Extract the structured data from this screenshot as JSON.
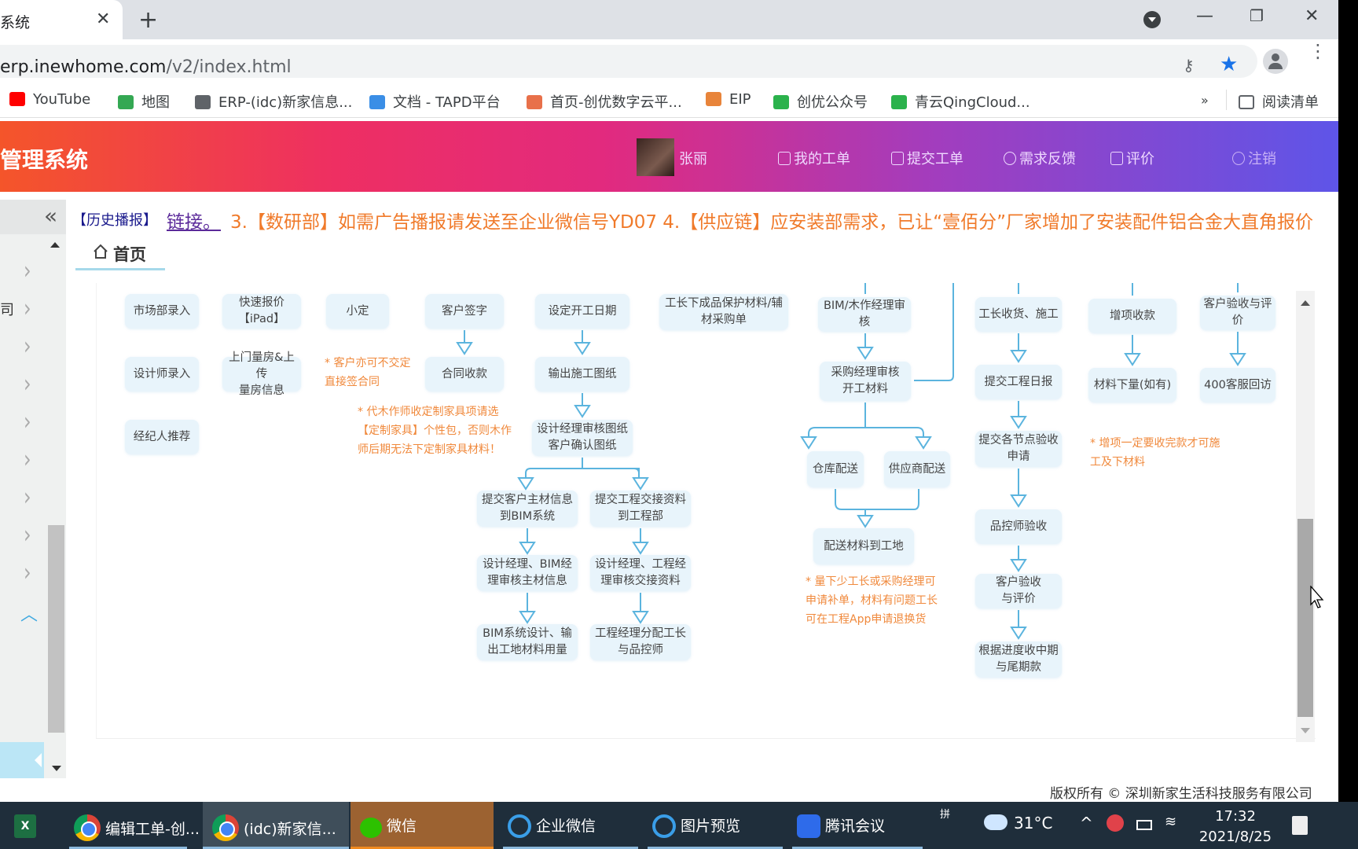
{
  "browser": {
    "tab_title": "系统",
    "url_host": "erp.inewhome.com",
    "url_path": "/v2/index.html",
    "bookmarks": [
      {
        "label": "YouTube",
        "icon": "youtube-icon",
        "color": "#ff0000"
      },
      {
        "label": "地图",
        "icon": "maps-icon",
        "color": "#34a853"
      },
      {
        "label": "ERP-(idc)新家信息...",
        "icon": "globe-icon",
        "color": "#5f6368"
      },
      {
        "label": "文档 - TAPD平台",
        "icon": "tapd-icon",
        "color": "#3a8ee6"
      },
      {
        "label": "首页-创优数字云平...",
        "icon": "home-icon",
        "color": "#e8704a"
      },
      {
        "label": "EIP",
        "icon": "eip-icon",
        "color": "#e8843a"
      },
      {
        "label": "创优公众号",
        "icon": "refresh-icon",
        "color": "#2bb24c"
      },
      {
        "label": "青云QingCloud...",
        "icon": "qingcloud-icon",
        "color": "#2bb24c"
      }
    ],
    "more_bookmarks": "»",
    "reading_list": "阅读清单"
  },
  "app": {
    "title": "管理系统",
    "user_name": "张丽",
    "nav": [
      {
        "label": "我的工单",
        "icon": "my-ticket-icon"
      },
      {
        "label": "提交工单",
        "icon": "submit-ticket-icon"
      },
      {
        "label": "需求反馈",
        "icon": "feedback-icon"
      },
      {
        "label": "评价",
        "icon": "comment-icon"
      },
      {
        "label": "注销",
        "icon": "logout-icon"
      }
    ]
  },
  "sidebar": {
    "items": [
      {
        "label": ""
      },
      {
        "label": "司"
      },
      {
        "label": ""
      },
      {
        "label": ""
      },
      {
        "label": ""
      },
      {
        "label": ""
      },
      {
        "label": ""
      },
      {
        "label": ""
      },
      {
        "label": ""
      }
    ]
  },
  "notice": {
    "tag": "【历史播报】",
    "link": "链接。",
    "message": "3.【数研部】如需广告播报请发送至企业微信号YD07 4.【供应链】应安装部需求，已让“壹佰分”厂家增加了安装配件铝合金大直角报价"
  },
  "home_tab": {
    "label": "首页"
  },
  "flowchart": {
    "nodes": [
      {
        "id": "n1",
        "text": "市场部录入"
      },
      {
        "id": "n2",
        "text": "设计师录入"
      },
      {
        "id": "n3",
        "text": "经纪人推荐"
      },
      {
        "id": "n4",
        "text": "快速报价\n【iPad】"
      },
      {
        "id": "n5",
        "text": "上门量房&上传\n量房信息"
      },
      {
        "id": "n6",
        "text": "小定"
      },
      {
        "id": "n7",
        "text": "客户签字"
      },
      {
        "id": "n8",
        "text": "合同收款"
      },
      {
        "id": "n9",
        "text": "设定开工日期"
      },
      {
        "id": "n10",
        "text": "输出施工图纸"
      },
      {
        "id": "n11",
        "text": "设计经理审核图纸\n客户确认图纸"
      },
      {
        "id": "n12",
        "text": "提交客户主材信息\n到BIM系统"
      },
      {
        "id": "n13",
        "text": "设计经理、BIM经\n理审核主材信息"
      },
      {
        "id": "n14",
        "text": "BIM系统设计、输\n出工地材料用量"
      },
      {
        "id": "n15",
        "text": "提交工程交接资料\n到工程部"
      },
      {
        "id": "n16",
        "text": "设计经理、工程经\n理审核交接资料"
      },
      {
        "id": "n17",
        "text": "工程经理分配工长\n与品控师"
      },
      {
        "id": "n18",
        "text": "工长下成品保护材料/辅\n材采购单"
      },
      {
        "id": "n19",
        "text": "BIM/木作经理审核"
      },
      {
        "id": "n20",
        "text": "采购经理审核\n开工材料"
      },
      {
        "id": "n21",
        "text": "仓库配送"
      },
      {
        "id": "n22",
        "text": "供应商配送"
      },
      {
        "id": "n23",
        "text": "配送材料到工地"
      },
      {
        "id": "n24",
        "text": "工长收货、施工"
      },
      {
        "id": "n25",
        "text": "提交工程日报"
      },
      {
        "id": "n26",
        "text": "提交各节点验收\n申请"
      },
      {
        "id": "n27",
        "text": "品控师验收"
      },
      {
        "id": "n28",
        "text": "客户验收\n与评价"
      },
      {
        "id": "n29",
        "text": "根据进度收中期\n与尾期款"
      },
      {
        "id": "n30",
        "text": "增项收款"
      },
      {
        "id": "n31",
        "text": "材料下量(如有)"
      },
      {
        "id": "n32",
        "text": "客户验收与评\n价"
      },
      {
        "id": "n33",
        "text": "400客服回访"
      }
    ],
    "notes": [
      {
        "id": "note1",
        "text": "* 客户亦可不交定\n直接签合同"
      },
      {
        "id": "note2",
        "text": "* 代木作师收定制家具项请选\n【定制家具】个性包，否则木作\n师后期无法下定制家具材料！"
      },
      {
        "id": "note3",
        "text": "* 量下少工长或采购经理可\n申请补单，材料有问题工长\n可在工程App申请退换货"
      },
      {
        "id": "note4",
        "text": "* 增项一定要收完款才可施\n工及下材料"
      }
    ]
  },
  "footer": {
    "copyright": "版权所有 © 深圳新家生活科技服务有限公司"
  },
  "taskbar": {
    "apps": [
      {
        "label": "",
        "icon": "excel-icon"
      },
      {
        "label": "编辑工单-创...",
        "icon": "chrome-icon"
      },
      {
        "label": "(idc)新家信...",
        "icon": "chrome-icon"
      },
      {
        "label": "微信",
        "icon": "wechat-icon"
      },
      {
        "label": "企业微信",
        "icon": "wecom-icon"
      },
      {
        "label": "图片预览",
        "icon": "wecom-icon"
      },
      {
        "label": "腾讯会议",
        "icon": "tencent-meeting-icon"
      }
    ],
    "ime": "拼",
    "temperature": "31°C",
    "time": "17:32",
    "date": "2021/8/25"
  },
  "colors": {
    "header_gradient_start": "#f4552a",
    "header_gradient_end": "#5e55e8",
    "node_bg": "#e8f4fb",
    "arrow": "#5bb4de",
    "note_text": "#f0893c",
    "notice_text": "#f07a2a"
  }
}
